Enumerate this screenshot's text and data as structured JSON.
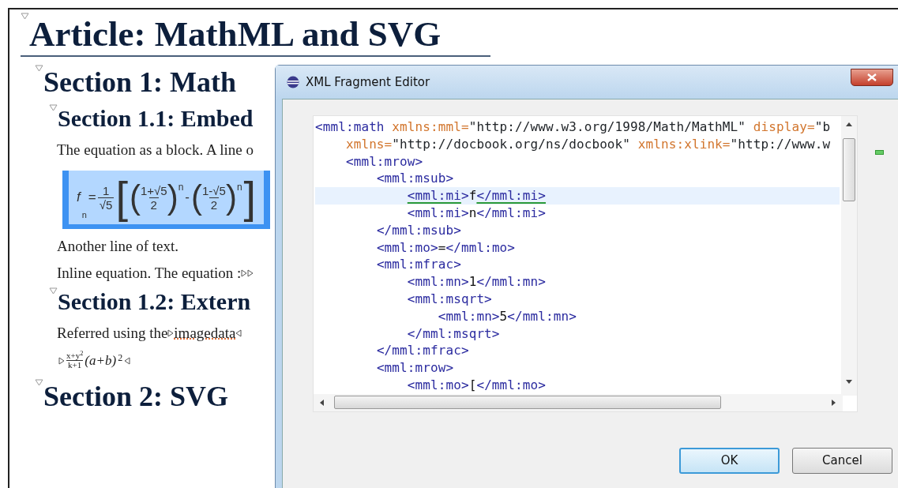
{
  "document": {
    "title": {
      "text": "Article: MathML and SVG",
      "expanded": true
    },
    "blocks": [
      {
        "kind": "section",
        "text": "Section 1: Math",
        "expanded": true
      },
      {
        "kind": "subsection",
        "text": "Section 1.1: Embed",
        "expanded": true
      },
      {
        "kind": "para",
        "text": "The equation as a block. A line o"
      },
      {
        "kind": "equation",
        "selected": true,
        "tokens": [
          {
            "kind": "ident",
            "text": "f",
            "sub": "n"
          },
          {
            "kind": "sym",
            "text": "="
          },
          {
            "kind": "frac",
            "num": "1",
            "den": "√5"
          },
          {
            "kind": "bracket",
            "text": "["
          },
          {
            "kind": "group",
            "open": "(",
            "num": "1+√5",
            "den": "2",
            "close": ")",
            "sup": "n"
          },
          {
            "kind": "sym",
            "text": "-"
          },
          {
            "kind": "group",
            "open": "(",
            "num": "1-√5",
            "den": "2",
            "close": ")",
            "sup": "n"
          },
          {
            "kind": "bracket",
            "text": "]"
          }
        ]
      },
      {
        "kind": "para",
        "text": "Another line of text."
      },
      {
        "kind": "para_markers",
        "text": "Inline equation. The equation :"
      },
      {
        "kind": "subsection",
        "text": "Section 1.2: Extern",
        "expanded": true
      },
      {
        "kind": "para",
        "text": "Referred using the ",
        "element": "imagedata"
      },
      {
        "kind": "inline_equation",
        "tokens": [
          {
            "kind": "frac",
            "num": "x+y$^{2}$",
            "den": "k+1"
          },
          {
            "kind": "ident",
            "text": "(a+b)",
            "sup": "2"
          }
        ]
      },
      {
        "kind": "section",
        "text": "Section 2: SVG",
        "expanded": true
      }
    ]
  },
  "dialog": {
    "title": "XML Fragment Editor",
    "lines": [
      {
        "current": false,
        "tokens": [
          {
            "kind": "tag",
            "text": "<mml:math"
          },
          {
            "kind": "attr",
            "text": " xmlns:mml="
          },
          {
            "kind": "value",
            "text": "\"http://www.w3.org/1998/Math/MathML\""
          },
          {
            "kind": "attr",
            "text": " display="
          },
          {
            "kind": "value",
            "text": "\"b"
          }
        ]
      },
      {
        "current": false,
        "tokens": [
          {
            "kind": "attr",
            "text": "    xmlns="
          },
          {
            "kind": "value",
            "text": "\"http://docbook.org/ns/docbook\""
          },
          {
            "kind": "attr",
            "text": " xmlns:xlink="
          },
          {
            "kind": "value",
            "text": "\"http://www.w"
          }
        ]
      },
      {
        "current": false,
        "tokens": [
          {
            "kind": "tag",
            "text": "    <mml:mrow>"
          }
        ]
      },
      {
        "current": false,
        "tokens": [
          {
            "kind": "tag",
            "text": "        <mml:msub>"
          }
        ]
      },
      {
        "current": true,
        "tokens": [
          {
            "kind": "tag",
            "text": "            <mml:mi",
            "matched": true
          },
          {
            "kind": "tag",
            "text": ">"
          },
          {
            "kind": "text",
            "text": "f"
          },
          {
            "kind": "tag",
            "text": "</mml:mi>",
            "matched": true
          }
        ]
      },
      {
        "current": false,
        "tokens": [
          {
            "kind": "tag",
            "text": "            <mml:mi>"
          },
          {
            "kind": "text",
            "text": "n"
          },
          {
            "kind": "tag",
            "text": "</mml:mi>"
          }
        ]
      },
      {
        "current": false,
        "tokens": [
          {
            "kind": "tag",
            "text": "        </mml:msub>"
          }
        ]
      },
      {
        "current": false,
        "tokens": [
          {
            "kind": "tag",
            "text": "        <mml:mo>"
          },
          {
            "kind": "text",
            "text": "="
          },
          {
            "kind": "tag",
            "text": "</mml:mo>"
          }
        ]
      },
      {
        "current": false,
        "tokens": [
          {
            "kind": "tag",
            "text": "        <mml:mfrac>"
          }
        ]
      },
      {
        "current": false,
        "tokens": [
          {
            "kind": "tag",
            "text": "            <mml:mn>"
          },
          {
            "kind": "text",
            "text": "1"
          },
          {
            "kind": "tag",
            "text": "</mml:mn>"
          }
        ]
      },
      {
        "current": false,
        "tokens": [
          {
            "kind": "tag",
            "text": "            <mml:msqrt>"
          }
        ]
      },
      {
        "current": false,
        "tokens": [
          {
            "kind": "tag",
            "text": "                <mml:mn>"
          },
          {
            "kind": "text",
            "text": "5"
          },
          {
            "kind": "tag",
            "text": "</mml:mn>"
          }
        ]
      },
      {
        "current": false,
        "tokens": [
          {
            "kind": "tag",
            "text": "            </mml:msqrt>"
          }
        ]
      },
      {
        "current": false,
        "tokens": [
          {
            "kind": "tag",
            "text": "        </mml:mfrac>"
          }
        ]
      },
      {
        "current": false,
        "tokens": [
          {
            "kind": "tag",
            "text": "        <mml:mrow>"
          }
        ]
      },
      {
        "current": false,
        "tokens": [
          {
            "kind": "tag",
            "text": "            <mml:mo>"
          },
          {
            "kind": "text",
            "text": "["
          },
          {
            "kind": "tag",
            "text": "</mml:mo>"
          }
        ]
      }
    ],
    "buttons": [
      {
        "label": "OK",
        "default": true
      },
      {
        "label": "Cancel",
        "default": false
      }
    ]
  }
}
